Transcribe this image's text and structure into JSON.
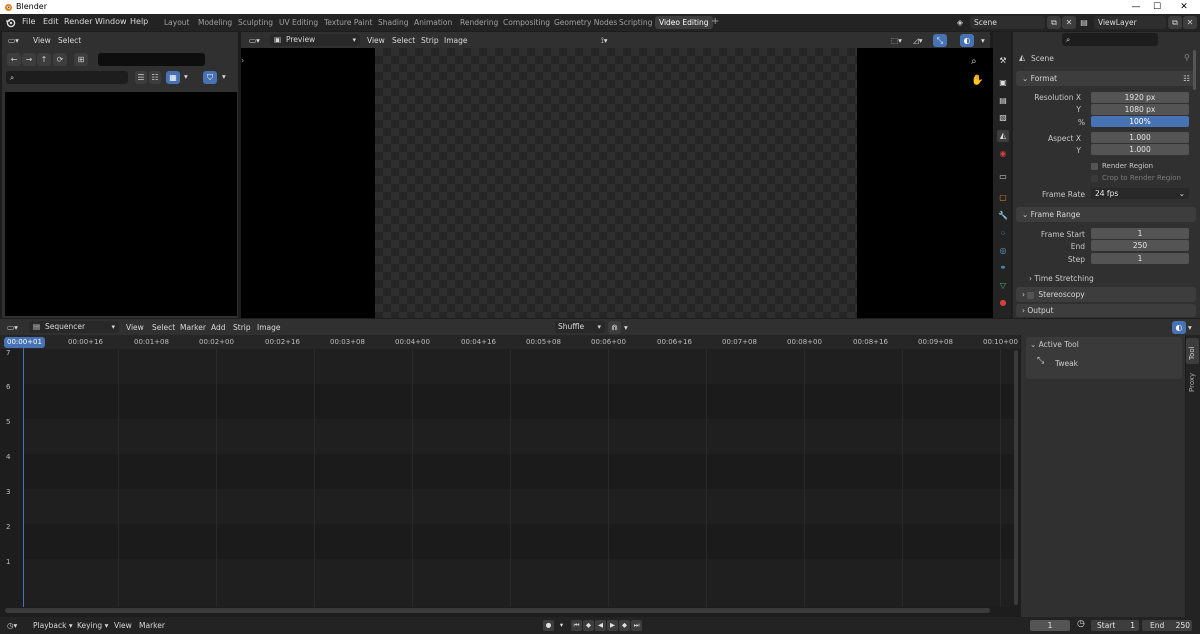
{
  "window": {
    "title": "Blender",
    "minimize": "—",
    "maximize": "☐",
    "close": "✕"
  },
  "menu": [
    "File",
    "Edit",
    "Render",
    "Window",
    "Help"
  ],
  "workspaces": [
    "Layout",
    "Modeling",
    "Sculpting",
    "UV Editing",
    "Texture Paint",
    "Shading",
    "Animation",
    "Rendering",
    "Compositing",
    "Geometry Nodes",
    "Scripting",
    "Video Editing"
  ],
  "active_workspace": "Video Editing",
  "add_tab": "+",
  "scene": {
    "name": "Scene",
    "view_layer": "ViewLayer"
  },
  "file_browser": {
    "menu": [
      "View",
      "Select"
    ]
  },
  "preview": {
    "mode": "Preview",
    "menu": [
      "View",
      "Select",
      "Strip",
      "Image"
    ]
  },
  "properties": {
    "search_placeholder": "",
    "context": "Scene",
    "format": {
      "header": "Format",
      "resolution_x_label": "Resolution X",
      "resolution_x": "1920 px",
      "resolution_y_label": "Y",
      "resolution_y": "1080 px",
      "percent_label": "%",
      "percent": "100%",
      "aspect_x_label": "Aspect X",
      "aspect_x": "1.000",
      "aspect_y_label": "Y",
      "aspect_y": "1.000",
      "render_region": "Render Region",
      "crop_region": "Crop to Render Region",
      "frame_rate_label": "Frame Rate",
      "frame_rate": "24 fps"
    },
    "frame_range": {
      "header": "Frame Range",
      "start_label": "Frame Start",
      "start": "1",
      "end_label": "End",
      "end": "250",
      "step_label": "Step",
      "step": "1"
    },
    "time_stretching": "Time Stretching",
    "stereoscopy": "Stereoscopy",
    "output": "Output"
  },
  "sequencer": {
    "mode": "Sequencer",
    "menu": [
      "View",
      "Select",
      "Marker",
      "Add",
      "Strip",
      "Image"
    ],
    "overlap_mode": "Shuffle",
    "current_frame": "00:00+01",
    "ruler": [
      "00:00+16",
      "00:01+08",
      "00:02+00",
      "00:02+16",
      "00:03+08",
      "00:04+00",
      "00:04+16",
      "00:05+08",
      "00:06+00",
      "00:06+16",
      "00:07+08",
      "00:08+00",
      "00:08+16",
      "00:09+08",
      "00:10+00"
    ],
    "channels": [
      "7",
      "6",
      "5",
      "4",
      "3",
      "2",
      "1"
    ],
    "sidebar": {
      "active_tool_header": "Active Tool",
      "tool": "Tweak",
      "tabs": [
        "Tool",
        "Proxy"
      ]
    }
  },
  "timeline": {
    "menu": [
      "Playback",
      "Keying",
      "View",
      "Marker"
    ],
    "current": "1",
    "start_label": "Start",
    "start": "1",
    "end_label": "End",
    "end": "250"
  }
}
